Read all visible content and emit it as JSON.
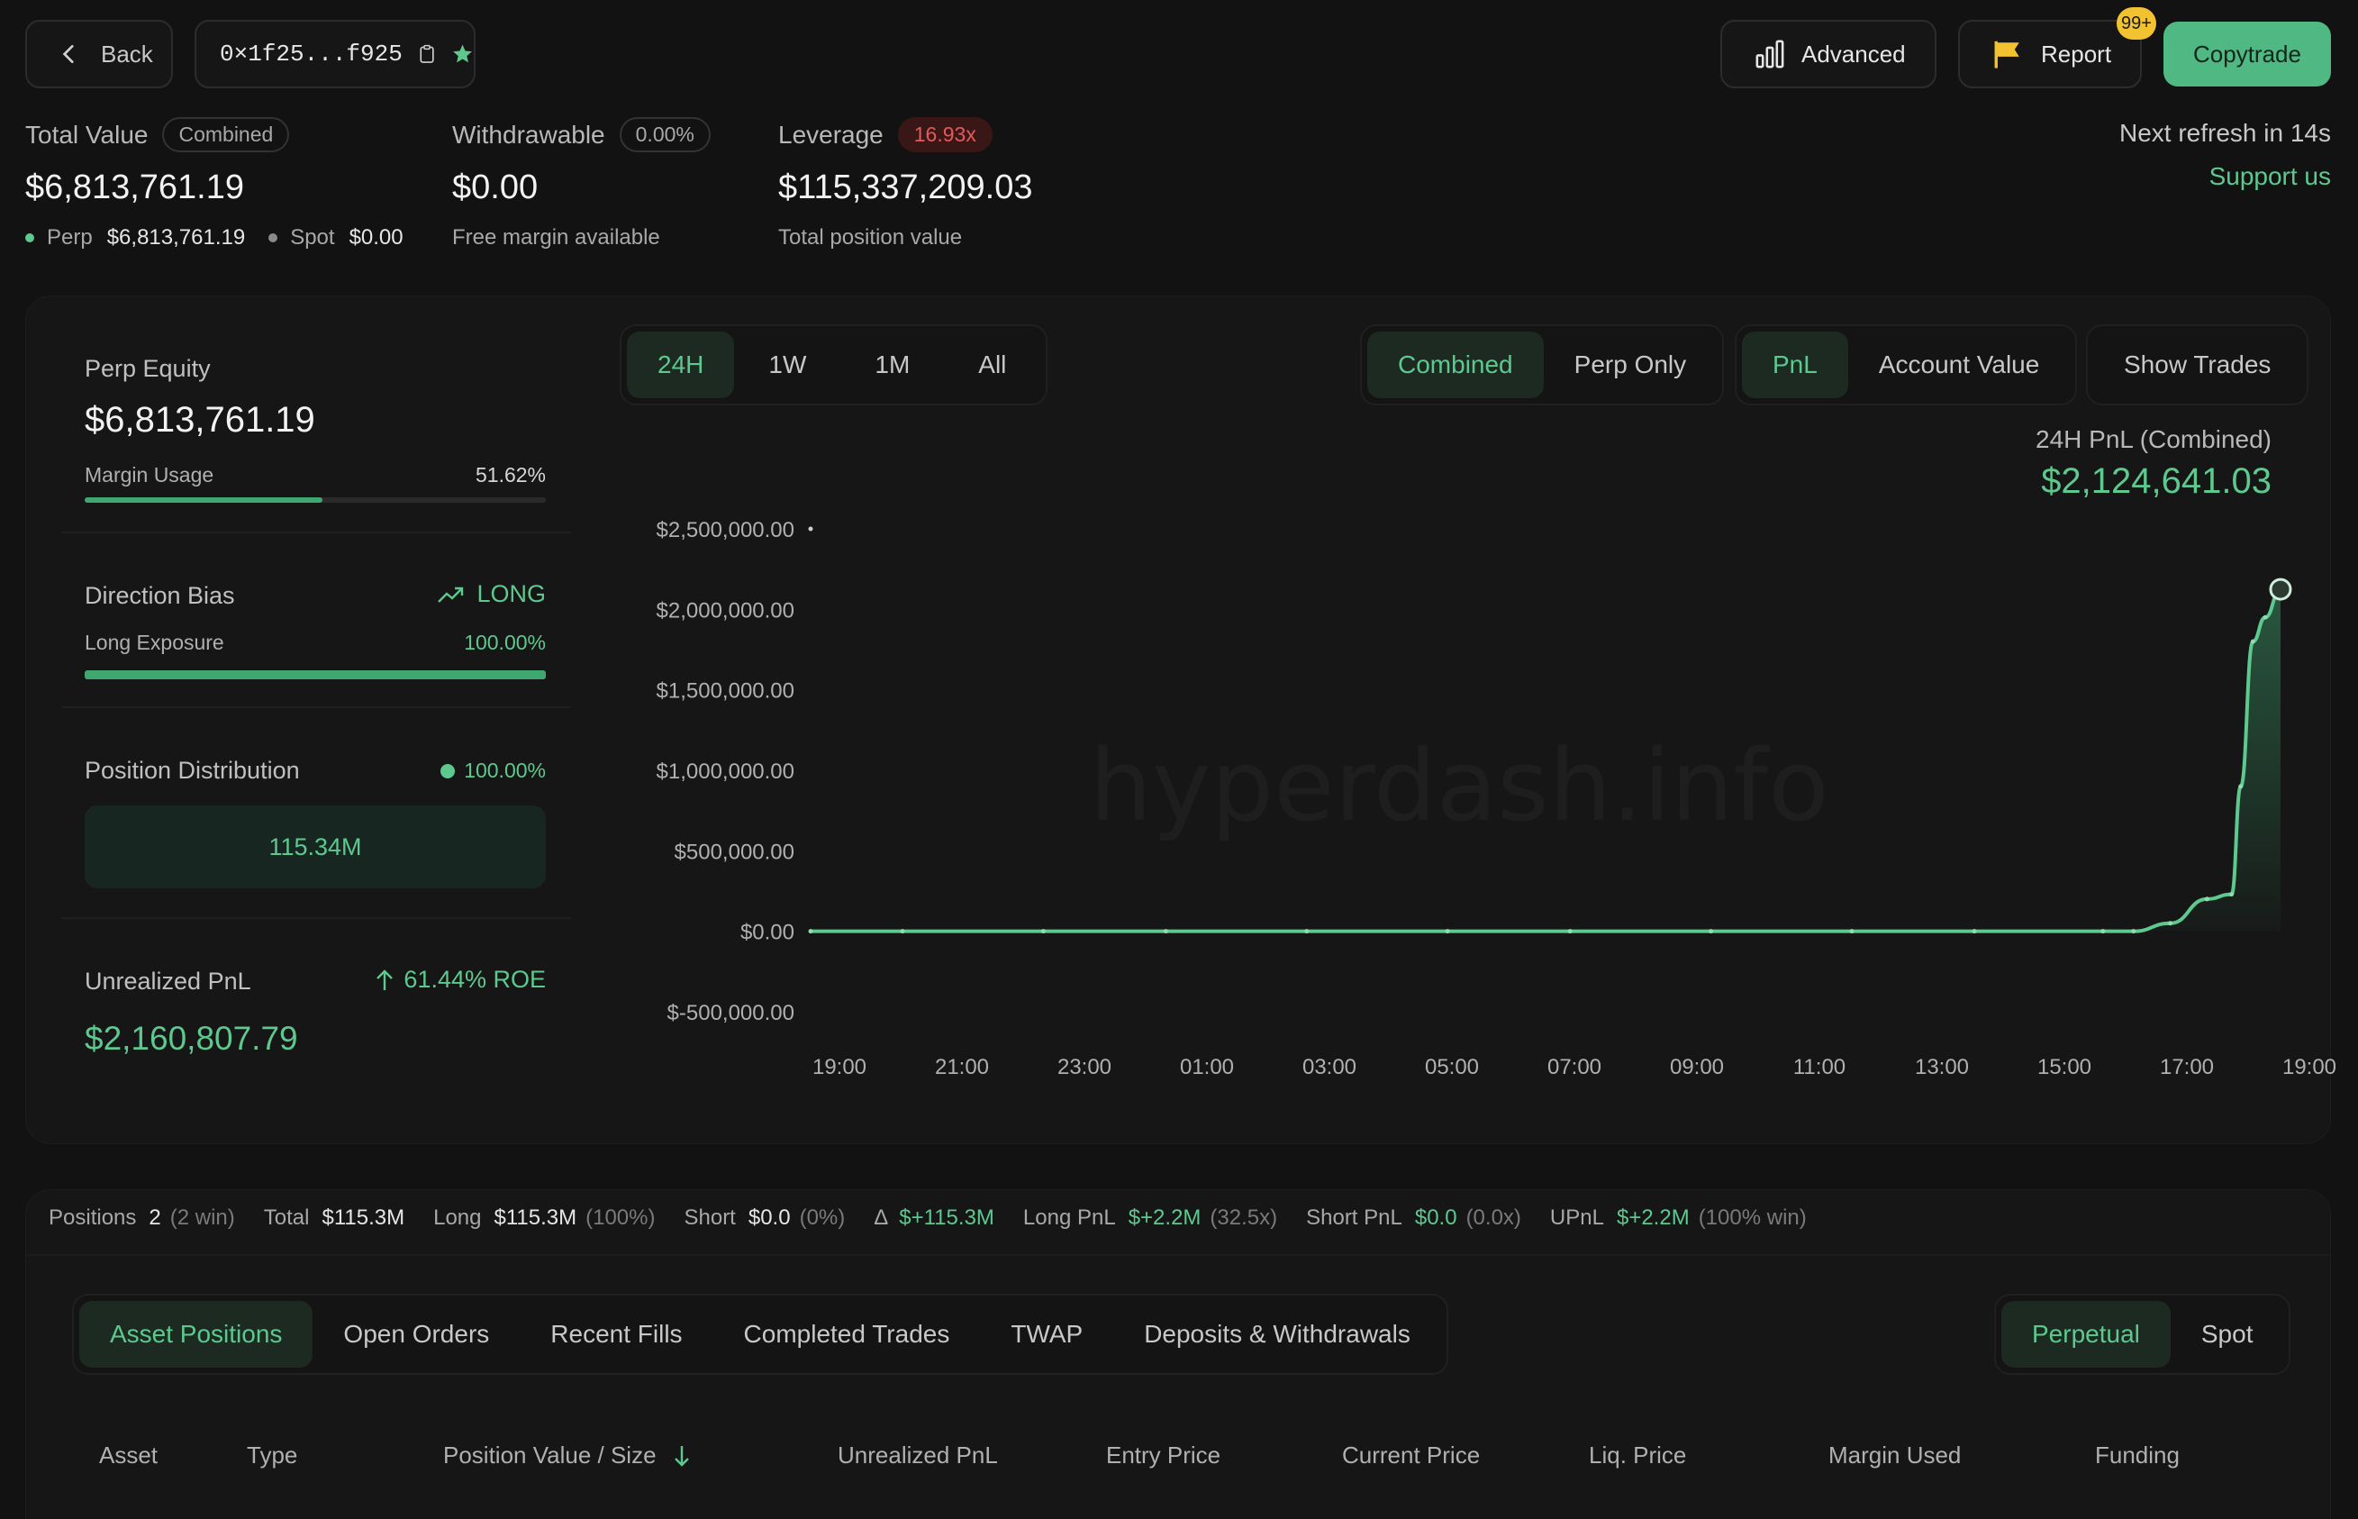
{
  "header": {
    "back_label": "Back",
    "address": "0×1f25...f925",
    "advanced_label": "Advanced",
    "report_label": "Report",
    "report_badge": "99+",
    "copytrade_label": "Copytrade",
    "refresh_text": "Next refresh in 14s",
    "support_label": "Support us"
  },
  "summary": {
    "total_value_label": "Total Value",
    "total_value_badge": "Combined",
    "total_value": "$6,813,761.19",
    "perp_label": "Perp",
    "perp_value": "$6,813,761.19",
    "spot_label": "Spot",
    "spot_value": "$0.00",
    "withdrawable_label": "Withdrawable",
    "withdrawable_badge": "0.00%",
    "withdrawable_value": "$0.00",
    "withdrawable_sub": "Free margin available",
    "leverage_label": "Leverage",
    "leverage_badge": "16.93x",
    "leverage_value": "$115,337,209.03",
    "leverage_sub": "Total position value"
  },
  "side": {
    "perp_equity_label": "Perp Equity",
    "perp_equity_value": "$6,813,761.19",
    "margin_usage_label": "Margin Usage",
    "margin_usage_value": "51.62%",
    "margin_usage_fraction": 0.5162,
    "direction_label": "Direction Bias",
    "direction_value": "LONG",
    "long_exposure_label": "Long Exposure",
    "long_exposure_value": "100.00%",
    "long_exposure_fraction": 1.0,
    "position_dist_label": "Position Distribution",
    "position_dist_value": "100.00%",
    "position_dist_bar": "115.34M",
    "upnl_label": "Unrealized PnL",
    "upnl_roe": "61.44% ROE",
    "upnl_value": "$2,160,807.79"
  },
  "chart_controls": {
    "ranges": [
      "24H",
      "1W",
      "1M",
      "All"
    ],
    "modes": [
      "Combined",
      "Perp Only"
    ],
    "metrics": [
      "PnL",
      "Account Value"
    ],
    "show_trades": "Show Trades",
    "pnl_title": "24H PnL (Combined)",
    "pnl_value": "$2,124,641.03",
    "watermark": "hyperdash.info"
  },
  "chart_data": {
    "type": "area",
    "title": "24H PnL (Combined)",
    "xlabel": "",
    "ylabel": "",
    "ylim": [
      -500000,
      2500000
    ],
    "y_ticks": [
      "$2,500,000.00",
      "$2,000,000.00",
      "$1,500,000.00",
      "$1,000,000.00",
      "$500,000.00",
      "$0.00",
      "$-500,000.00"
    ],
    "y_tick_values": [
      2500000,
      2000000,
      1500000,
      1000000,
      500000,
      0,
      -500000
    ],
    "x_ticks": [
      "19:00",
      "21:00",
      "23:00",
      "01:00",
      "03:00",
      "05:00",
      "07:00",
      "09:00",
      "11:00",
      "13:00",
      "15:00",
      "17:00",
      "19:00"
    ],
    "x_hours": [
      0,
      2,
      4,
      6,
      8,
      10,
      12,
      14,
      16,
      18,
      20,
      22,
      24
    ],
    "series": [
      {
        "x_hours": [
          0,
          1.5,
          3.8,
          5.8,
          8.1,
          10.4,
          12.4,
          14.7,
          17.0,
          19.0,
          21.1,
          21.6,
          22.2,
          22.8,
          23.2,
          23.35,
          23.55,
          23.75,
          24.0
        ],
        "values": [
          0,
          0,
          0,
          0,
          0,
          0,
          0,
          0,
          0,
          0,
          0,
          0,
          50000,
          200000,
          230000,
          900000,
          1800000,
          1950000,
          2124641
        ]
      }
    ],
    "grid": false,
    "legend": "none"
  },
  "positions_summary": {
    "positions_label": "Positions",
    "positions_value": "2",
    "positions_note": "(2 win)",
    "total_label": "Total",
    "total_value": "$115.3M",
    "long_label": "Long",
    "long_value": "$115.3M",
    "long_note": "(100%)",
    "short_label": "Short",
    "short_value": "$0.0",
    "short_note": "(0%)",
    "delta_label": "Δ",
    "delta_value": "$+115.3M",
    "long_pnl_label": "Long PnL",
    "long_pnl_value": "$+2.2M",
    "long_pnl_note": "(32.5x)",
    "short_pnl_label": "Short PnL",
    "short_pnl_value": "$0.0",
    "short_pnl_note": "(0.0x)",
    "upnl_label": "UPnL",
    "upnl_value": "$+2.2M",
    "upnl_note": "(100% win)"
  },
  "tabs": [
    "Asset Positions",
    "Open Orders",
    "Recent Fills",
    "Completed Trades",
    "TWAP",
    "Deposits & Withdrawals"
  ],
  "market_tabs": [
    "Perpetual",
    "Spot"
  ],
  "table": {
    "columns": [
      "Asset",
      "Type",
      "Position Value / Size",
      "Unrealized PnL",
      "Entry Price",
      "Current Price",
      "Liq. Price",
      "Margin Used",
      "Funding"
    ]
  },
  "colors": {
    "background": "#121212",
    "accent": "#5dc98e",
    "danger": "#e45a5a",
    "badge": "#f2c230"
  }
}
